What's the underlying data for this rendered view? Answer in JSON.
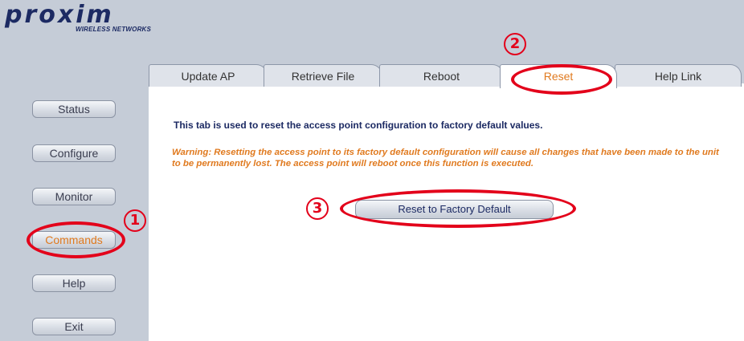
{
  "brand": {
    "logo_text": "proxim",
    "tagline": "WIRELESS NETWORKS"
  },
  "tabs": [
    {
      "label": "Update AP"
    },
    {
      "label": "Retrieve File"
    },
    {
      "label": "Reboot"
    },
    {
      "label": "Reset"
    },
    {
      "label": "Help Link"
    }
  ],
  "nav": [
    {
      "label": "Status"
    },
    {
      "label": "Configure"
    },
    {
      "label": "Monitor"
    },
    {
      "label": "Commands"
    },
    {
      "label": "Help"
    },
    {
      "label": "Exit"
    }
  ],
  "main": {
    "description": "This tab is used to reset the access point configuration to factory default values.",
    "warning": "Warning: Resetting the access point to its factory default configuration will cause all changes that have been made to the unit to be permanently lost. The access point will reboot once this function is executed.",
    "reset_button": "Reset to Factory Default"
  },
  "annotations": {
    "step1": "1",
    "step2": "2",
    "step3": "3"
  },
  "colors": {
    "accent": "#e07a1f",
    "brand": "#1c2a63",
    "annotation": "#e3001a",
    "background": "#c5ccd7"
  }
}
